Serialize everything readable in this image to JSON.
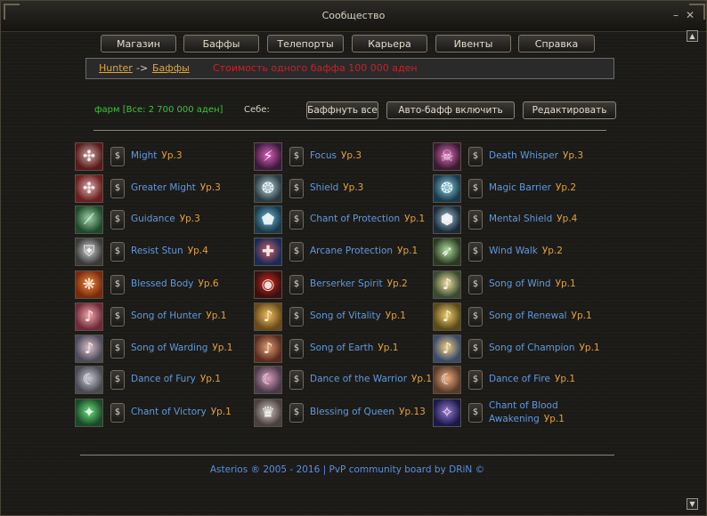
{
  "window": {
    "title": "Сообщество",
    "minimize": "–",
    "close": "✕"
  },
  "nav": [
    "Магазин",
    "Баффы",
    "Телепорты",
    "Карьера",
    "Ивенты",
    "Справка"
  ],
  "breadcrumb": {
    "first": "Hunter",
    "arrow": "->",
    "second": "Баффы",
    "cost": "Стоимость одного баффа 100 000 аден"
  },
  "controls": {
    "farm": "фарм [Все: 2 700 000 аден]",
    "self_label": "Себе:",
    "buff_all": "Баффнуть все",
    "auto_buff": "Авто-бафф включить",
    "edit": "Редактировать"
  },
  "buy_symbol": "$",
  "columns": [
    [
      {
        "name": "Might",
        "level": "Ур.3",
        "icon": "might-icon"
      },
      {
        "name": "Greater Might",
        "level": "Ур.3",
        "icon": "greater-might-icon"
      },
      {
        "name": "Guidance",
        "level": "Ур.3",
        "icon": "guidance-icon"
      },
      {
        "name": "Resist Stun",
        "level": "Ур.4",
        "icon": "resist-stun-icon"
      },
      {
        "name": "Blessed Body",
        "level": "Ур.6",
        "icon": "blessed-body-icon"
      },
      {
        "name": "Song of Hunter",
        "level": "Ур.1",
        "icon": "song-of-hunter-icon"
      },
      {
        "name": "Song of Warding",
        "level": "Ур.1",
        "icon": "song-of-warding-icon"
      },
      {
        "name": "Dance of Fury",
        "level": "Ур.1",
        "icon": "dance-of-fury-icon"
      },
      {
        "name": "Chant of Victory",
        "level": "Ур.1",
        "icon": "chant-of-victory-icon"
      }
    ],
    [
      {
        "name": "Focus",
        "level": "Ур.3",
        "icon": "focus-icon"
      },
      {
        "name": "Shield",
        "level": "Ур.3",
        "icon": "shield-icon"
      },
      {
        "name": "Chant of Protection",
        "level": "Ур.1",
        "icon": "chant-of-protection-icon"
      },
      {
        "name": "Arcane Protection",
        "level": "Ур.1",
        "icon": "arcane-protection-icon"
      },
      {
        "name": "Berserker Spirit",
        "level": "Ур.2",
        "icon": "berserker-spirit-icon"
      },
      {
        "name": "Song of Vitality",
        "level": "Ур.1",
        "icon": "song-of-vitality-icon"
      },
      {
        "name": "Song of Earth",
        "level": "Ур.1",
        "icon": "song-of-earth-icon"
      },
      {
        "name": "Dance of the Warrior",
        "level": "Ур.1",
        "icon": "dance-of-the-warrior-icon"
      },
      {
        "name": "Blessing of Queen",
        "level": "Ур.13",
        "icon": "blessing-of-queen-icon"
      }
    ],
    [
      {
        "name": "Death Whisper",
        "level": "Ур.3",
        "icon": "death-whisper-icon"
      },
      {
        "name": "Magic Barrier",
        "level": "Ур.2",
        "icon": "magic-barrier-icon"
      },
      {
        "name": "Mental Shield",
        "level": "Ур.4",
        "icon": "mental-shield-icon"
      },
      {
        "name": "Wind Walk",
        "level": "Ур.2",
        "icon": "wind-walk-icon"
      },
      {
        "name": "Song of Wind",
        "level": "Ур.1",
        "icon": "song-of-wind-icon"
      },
      {
        "name": "Song of Renewal",
        "level": "Ур.1",
        "icon": "song-of-renewal-icon"
      },
      {
        "name": "Song of Champion",
        "level": "Ур.1",
        "icon": "song-of-champion-icon"
      },
      {
        "name": "Dance of Fire",
        "level": "Ур.1",
        "icon": "dance-of-fire-icon"
      },
      {
        "name": "Chant of Blood Awakening",
        "level": "Ур.1",
        "icon": "chant-of-blood-awakening-icon"
      }
    ]
  ],
  "footer": "Asterios ® 2005 - 2016 | PvP community board by DRiN ©",
  "scroll": {
    "up": "▲",
    "down": "▼"
  }
}
